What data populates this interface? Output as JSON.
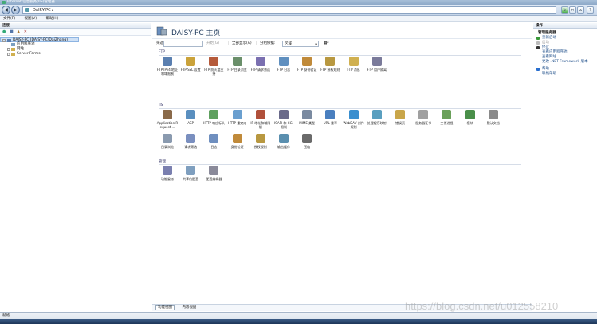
{
  "window": {
    "title": "Internet 信息服务(IIS)管理器"
  },
  "address": {
    "text": "DAISY-PC ▸"
  },
  "menu": [
    "文件(F)",
    "视图(V)",
    "帮助(H)"
  ],
  "connections": {
    "header": "连接",
    "tree": [
      {
        "label": "DAISY-PC (DAISY-PC\\DaiZhang)",
        "selected": true
      },
      {
        "label": "应用程序池"
      },
      {
        "label": "网站"
      },
      {
        "label": "Server Farms"
      }
    ]
  },
  "main": {
    "title": "DAISY-PC 主页",
    "filter": {
      "label": "筛选:",
      "start": "开始(G)",
      "showall": "全部显示(A)",
      "groupby": "分组依据:",
      "groupvalue": "区域"
    },
    "sections": [
      {
        "name": "FTP",
        "items": [
          {
            "label": "FTP IPv4 地址和域限制",
            "icon": "ftp-ipv4-icon",
            "color": "#5a7fb0"
          },
          {
            "label": "FTP SSL 设置",
            "icon": "ftp-ssl-icon",
            "color": "#caa23a"
          },
          {
            "label": "FTP 防火墙支持",
            "icon": "ftp-firewall-icon",
            "color": "#b55a3a"
          },
          {
            "label": "FTP 目录浏览",
            "icon": "ftp-directory-icon",
            "color": "#6a8f6a"
          },
          {
            "label": "FTP 请求筛选",
            "icon": "ftp-request-filter-icon",
            "color": "#7a6fb0"
          },
          {
            "label": "FTP 日志",
            "icon": "ftp-log-icon",
            "color": "#5f8fbf"
          },
          {
            "label": "FTP 身份验证",
            "icon": "ftp-auth-icon",
            "color": "#c08a3a"
          },
          {
            "label": "FTP 授权规则",
            "icon": "ftp-authz-icon",
            "color": "#b89840"
          },
          {
            "label": "FTP 消息",
            "icon": "ftp-message-icon",
            "color": "#d0b050"
          },
          {
            "label": "FTP 用户隔离",
            "icon": "ftp-user-isolation-icon",
            "color": "#7a7a9a"
          }
        ]
      },
      {
        "name": "IIS",
        "items": [
          {
            "label": "Application Request ...",
            "icon": "arr-icon",
            "color": "#8a6a4a"
          },
          {
            "label": "ASP",
            "icon": "asp-icon",
            "color": "#5a8fbf"
          },
          {
            "label": "HTTP 响应标头",
            "icon": "http-headers-icon",
            "color": "#5fa05f"
          },
          {
            "label": "HTTP 重定向",
            "icon": "http-redirect-icon",
            "color": "#6a9fcf"
          },
          {
            "label": "IP 地址和域限制",
            "icon": "ip-restrictions-icon",
            "color": "#b0503a"
          },
          {
            "label": "ISAPI 和 CGI 限制",
            "icon": "isapi-cgi-icon",
            "color": "#6a6a8a"
          },
          {
            "label": "MIME 类型",
            "icon": "mime-icon",
            "color": "#7a8aa0"
          },
          {
            "label": "URL 重写",
            "icon": "url-rewrite-icon",
            "color": "#4a7fbf"
          },
          {
            "label": "WebDAV 创作规则",
            "icon": "webdav-icon",
            "color": "#3a8fcf"
          },
          {
            "label": "处理程序映射",
            "icon": "handler-mappings-icon",
            "color": "#5a9fbf"
          },
          {
            "label": "错误页",
            "icon": "error-pages-icon",
            "color": "#c9a64a"
          },
          {
            "label": "服务器证书",
            "icon": "server-cert-icon",
            "color": "#a0a0a0"
          },
          {
            "label": "工作进程",
            "icon": "worker-process-icon",
            "color": "#6aa05a"
          },
          {
            "label": "模块",
            "icon": "modules-icon",
            "color": "#4a8f4a"
          },
          {
            "label": "默认文档",
            "icon": "default-doc-icon",
            "color": "#8a8a8a"
          },
          {
            "label": "目录浏览",
            "icon": "dir-browse-icon",
            "color": "#8a9aaf"
          },
          {
            "label": "请求筛选",
            "icon": "request-filter-icon",
            "color": "#7a8fbf"
          },
          {
            "label": "日志",
            "icon": "logging-icon",
            "color": "#6f8fbf"
          },
          {
            "label": "身份验证",
            "icon": "authentication-icon",
            "color": "#c08a3a"
          },
          {
            "label": "授权规则",
            "icon": "authorization-icon",
            "color": "#b89840"
          },
          {
            "label": "输出缓存",
            "icon": "output-cache-icon",
            "color": "#5a8faf"
          },
          {
            "label": "压缩",
            "icon": "compression-icon",
            "color": "#6a6a6a"
          }
        ]
      },
      {
        "name": "管理",
        "items": [
          {
            "label": "功能委派",
            "icon": "feature-delegation-icon",
            "color": "#7a7faf"
          },
          {
            "label": "共享的配置",
            "icon": "shared-config-icon",
            "color": "#7f9fbf"
          },
          {
            "label": "配置编辑器",
            "icon": "config-editor-icon",
            "color": "#8a8a9a"
          }
        ]
      }
    ],
    "tabs": {
      "features": "功能视图",
      "content": "内容视图"
    }
  },
  "actions": {
    "header": "操作",
    "groups": [
      {
        "title": "管理服务器",
        "items": [
          {
            "label": "重新启动",
            "icon": "restart-icon",
            "color": "#3a9a3a",
            "enabled": true
          },
          {
            "label": "启动",
            "icon": "start-icon",
            "color": "#bbbbbb",
            "enabled": false
          },
          {
            "label": "停止",
            "icon": "stop-icon",
            "color": "#333333",
            "enabled": true
          },
          {
            "label": "查看应用程序池",
            "enabled": true
          },
          {
            "label": "查看网站",
            "enabled": true
          },
          {
            "label": "更改 .NET Framework 版本",
            "enabled": true
          }
        ]
      },
      {
        "title": "",
        "items": [
          {
            "label": "帮助",
            "icon": "help-icon",
            "color": "#2a6fcf",
            "enabled": true
          },
          {
            "label": "联机帮助",
            "enabled": true
          }
        ]
      }
    ]
  },
  "status": {
    "text": "就绪"
  },
  "watermark": "https://blog.csdn.net/u012558210"
}
